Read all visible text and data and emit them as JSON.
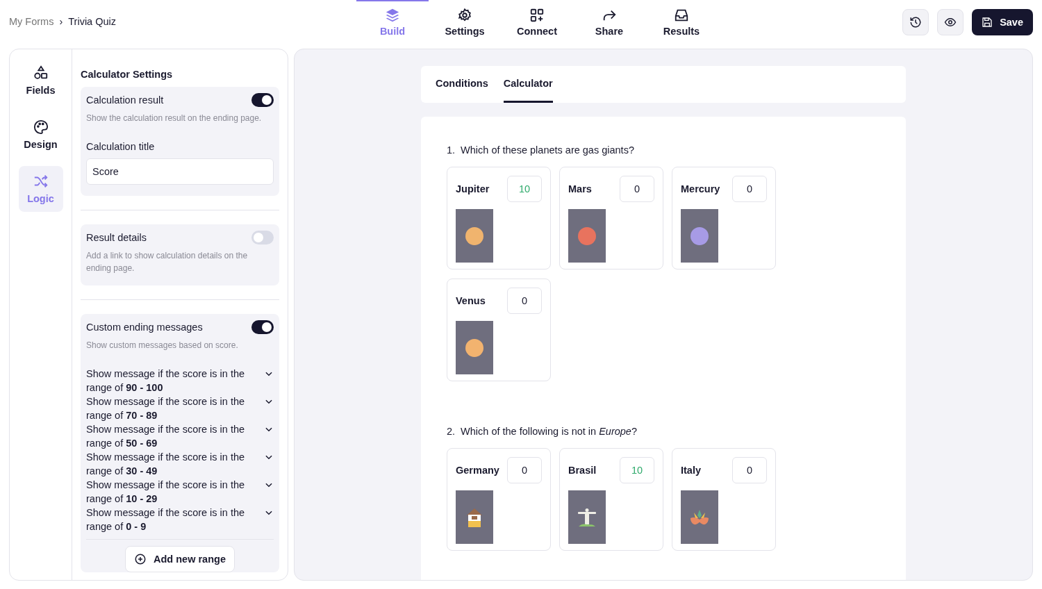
{
  "breadcrumb": {
    "parent": "My Forms",
    "separator": "›",
    "current": "Trivia Quiz"
  },
  "nav": [
    {
      "label": "Build",
      "selected": true
    },
    {
      "label": "Settings",
      "selected": false
    },
    {
      "label": "Connect",
      "selected": false
    },
    {
      "label": "Share",
      "selected": false
    },
    {
      "label": "Results",
      "selected": false
    }
  ],
  "actions": {
    "save": "Save"
  },
  "rail": [
    {
      "label": "Fields",
      "selected": false
    },
    {
      "label": "Design",
      "selected": false
    },
    {
      "label": "Logic",
      "selected": true
    }
  ],
  "settings": {
    "title": "Calculator Settings",
    "calculation_result": {
      "label": "Calculation result",
      "on": true,
      "description": "Show the calculation result on the ending page.",
      "field_label": "Calculation title",
      "field_value": "Score"
    },
    "result_details": {
      "label": "Result details",
      "on": false,
      "description": "Add a link to show calculation details on the ending page."
    },
    "custom_endings": {
      "label": "Custom ending messages",
      "on": true,
      "description": "Show custom messages based on score.",
      "ranges": [
        "Show message if the score is in the range of **90 - 100**",
        "Show message if the score is in the range of **70 - 89**",
        "Show message if the score is in the range of **50 - 69**",
        "Show message if the score is in the range of **30 - 49**",
        "Show message if the score is in the range of **10 - 29**",
        "Show message if the score is in the range of **0 - 9**"
      ],
      "add_button": "Add new range"
    }
  },
  "tabs": [
    {
      "label": "Conditions",
      "selected": false
    },
    {
      "label": "Calculator",
      "selected": true
    }
  ],
  "questions": [
    {
      "number": "1.",
      "text": "Which of these planets are gas giants?",
      "options": [
        {
          "name": "Jupiter",
          "score": "10",
          "positive": true,
          "kind": "gas-planet"
        },
        {
          "name": "Mars",
          "score": "0",
          "positive": false,
          "kind": "red-planet"
        },
        {
          "name": "Mercury",
          "score": "0",
          "positive": false,
          "kind": "purple-planet"
        },
        {
          "name": "Venus",
          "score": "0",
          "positive": false,
          "kind": "orange-planet"
        }
      ]
    },
    {
      "number": "2.",
      "text": "Which of the following is not in *Europe*?",
      "options": [
        {
          "name": "Germany",
          "score": "0",
          "positive": false,
          "kind": "house"
        },
        {
          "name": "Brasil",
          "score": "10",
          "positive": true,
          "kind": "statue"
        },
        {
          "name": "Italy",
          "score": "0",
          "positive": false,
          "kind": "mask"
        }
      ]
    }
  ]
}
